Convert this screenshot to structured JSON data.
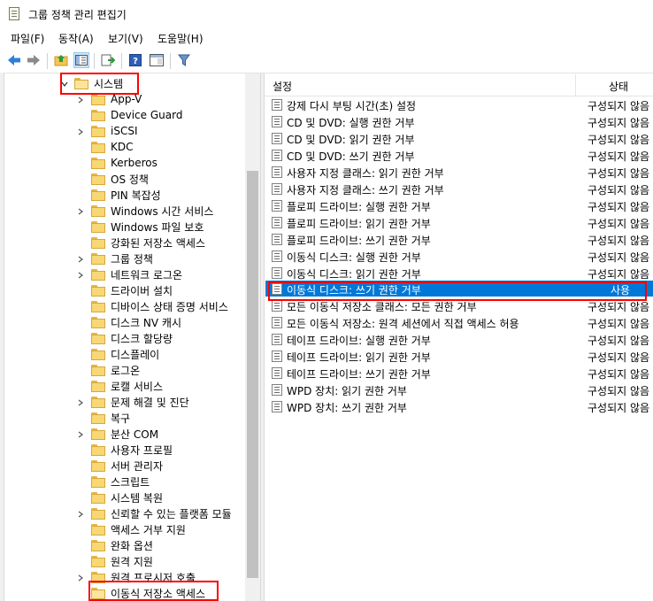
{
  "window": {
    "title": "그룹 정책 관리 편집기"
  },
  "menu": [
    "파일(F)",
    "동작(A)",
    "보기(V)",
    "도움말(H)"
  ],
  "toolbar": [
    "back-icon",
    "forward-icon",
    "up-folder-icon",
    "show-hide-tree-icon",
    "export-list-icon",
    "help-icon",
    "properties-pane-icon",
    "filter-icon"
  ],
  "tree": {
    "parent": {
      "label": "시스템",
      "expanded": true
    },
    "items": [
      {
        "label": "App-V",
        "expandable": true
      },
      {
        "label": "Device Guard",
        "expandable": false
      },
      {
        "label": "iSCSI",
        "expandable": true
      },
      {
        "label": "KDC",
        "expandable": false
      },
      {
        "label": "Kerberos",
        "expandable": false
      },
      {
        "label": "OS 정책",
        "expandable": false
      },
      {
        "label": "PIN 복잡성",
        "expandable": false
      },
      {
        "label": "Windows 시간 서비스",
        "expandable": true
      },
      {
        "label": "Windows 파일 보호",
        "expandable": false
      },
      {
        "label": "강화된 저장소 액세스",
        "expandable": false
      },
      {
        "label": "그룹 정책",
        "expandable": true
      },
      {
        "label": "네트워크 로그온",
        "expandable": true
      },
      {
        "label": "드라이버 설치",
        "expandable": false
      },
      {
        "label": "디바이스 상태 증명 서비스",
        "expandable": false
      },
      {
        "label": "디스크 NV 캐시",
        "expandable": false
      },
      {
        "label": "디스크 할당량",
        "expandable": false
      },
      {
        "label": "디스플레이",
        "expandable": false
      },
      {
        "label": "로그온",
        "expandable": false
      },
      {
        "label": "로캘 서비스",
        "expandable": false
      },
      {
        "label": "문제 해결 및 진단",
        "expandable": true
      },
      {
        "label": "복구",
        "expandable": false
      },
      {
        "label": "분산 COM",
        "expandable": true
      },
      {
        "label": "사용자 프로필",
        "expandable": false
      },
      {
        "label": "서버 관리자",
        "expandable": false
      },
      {
        "label": "스크립트",
        "expandable": false
      },
      {
        "label": "시스템 복원",
        "expandable": false
      },
      {
        "label": "신뢰할 수 있는 플랫폼 모듈",
        "expandable": true
      },
      {
        "label": "액세스 거부 지원",
        "expandable": false
      },
      {
        "label": "완화 옵션",
        "expandable": false
      },
      {
        "label": "원격 지원",
        "expandable": false
      },
      {
        "label": "원격 프로시저 호출",
        "expandable": true
      },
      {
        "label": "이동식 저장소 액세스",
        "expandable": false,
        "selected": true
      }
    ]
  },
  "list": {
    "headers": {
      "setting": "설정",
      "state": "상태"
    },
    "rows": [
      {
        "name": "강제 다시 부팅 시간(초) 설정",
        "state": "구성되지 않음"
      },
      {
        "name": "CD 및 DVD: 실행 권한 거부",
        "state": "구성되지 않음"
      },
      {
        "name": "CD 및 DVD: 읽기 권한 거부",
        "state": "구성되지 않음"
      },
      {
        "name": "CD 및 DVD: 쓰기 권한 거부",
        "state": "구성되지 않음"
      },
      {
        "name": "사용자 지정 클래스: 읽기 권한 거부",
        "state": "구성되지 않음"
      },
      {
        "name": "사용자 지정 클래스: 쓰기 권한 거부",
        "state": "구성되지 않음"
      },
      {
        "name": "플로피 드라이브: 실행 권한 거부",
        "state": "구성되지 않음"
      },
      {
        "name": "플로피 드라이브: 읽기 권한 거부",
        "state": "구성되지 않음"
      },
      {
        "name": "플로피 드라이브: 쓰기 권한 거부",
        "state": "구성되지 않음"
      },
      {
        "name": "이동식 디스크: 실행 권한 거부",
        "state": "구성되지 않음"
      },
      {
        "name": "이동식 디스크: 읽기 권한 거부",
        "state": "구성되지 않음"
      },
      {
        "name": "이동식 디스크: 쓰기 권한 거부",
        "state": "사용",
        "selected": true
      },
      {
        "name": "모든 이동식 저장소 클래스: 모든 권한 거부",
        "state": "구성되지 않음"
      },
      {
        "name": "모든 이동식 저장소: 원격 세션에서 직접 액세스 허용",
        "state": "구성되지 않음"
      },
      {
        "name": "테이프 드라이브: 실행 권한 거부",
        "state": "구성되지 않음"
      },
      {
        "name": "테이프 드라이브: 읽기 권한 거부",
        "state": "구성되지 않음"
      },
      {
        "name": "테이프 드라이브: 쓰기 권한 거부",
        "state": "구성되지 않음"
      },
      {
        "name": "WPD 장치: 읽기 권한 거부",
        "state": "구성되지 않음"
      },
      {
        "name": "WPD 장치: 쓰기 권한 거부",
        "state": "구성되지 않음"
      }
    ]
  },
  "colors": {
    "selection": "#0078d7",
    "highlight": "#ff0000",
    "folder": "#f8d775"
  }
}
